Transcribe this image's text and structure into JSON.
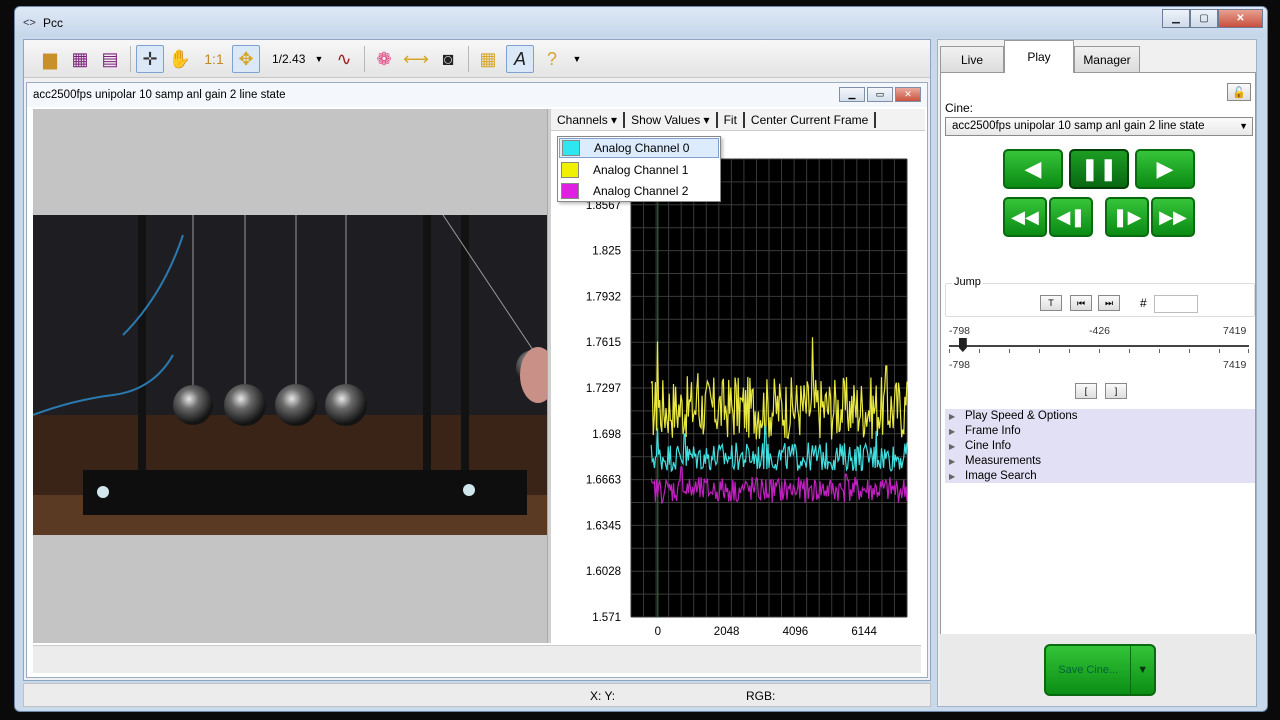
{
  "window": {
    "title": "Pcc"
  },
  "toolbar": {
    "zoom": "1/2.43"
  },
  "document": {
    "title": "acc2500fps unipolar 10 samp anl gain 2 line state"
  },
  "chart_toolbar": {
    "channels": "Channels",
    "show_values": "Show Values",
    "fit": "Fit",
    "center": "Center Current Frame"
  },
  "channels_menu": [
    {
      "label": "Analog Channel 0",
      "color": "#2ee6f0"
    },
    {
      "label": "Analog Channel 1",
      "color": "#f0f000"
    },
    {
      "label": "Analog Channel 2",
      "color": "#e020e0"
    }
  ],
  "chart_data": {
    "type": "line",
    "ylim": [
      1.571,
      1.8885
    ],
    "yticks": [
      "1.8567",
      "1.825",
      "1.7932",
      "1.7615",
      "1.7297",
      "1.698",
      "1.6663",
      "1.6345",
      "1.6028",
      "1.571"
    ],
    "xlim": [
      -798,
      7419
    ],
    "xticks": [
      "0",
      "2048",
      "4096",
      "6144"
    ],
    "grid": true,
    "series": [
      {
        "color": "#e8e840",
        "base": 1.716,
        "amp": 0.022,
        "spikes": [
          {
            "x": 0,
            "y": 1.762
          },
          {
            "x": 1200,
            "y": 1.74
          },
          {
            "x": 2300,
            "y": 1.737
          },
          {
            "x": 4600,
            "y": 1.765
          },
          {
            "x": 6800,
            "y": 1.745
          }
        ]
      },
      {
        "color": "#40e0e0",
        "base": 1.682,
        "amp": 0.01,
        "spikes": [
          {
            "x": 0,
            "y": 1.702
          },
          {
            "x": 800,
            "y": 1.698
          },
          {
            "x": 3200,
            "y": 1.703
          },
          {
            "x": 4700,
            "y": 1.69
          },
          {
            "x": 6500,
            "y": 1.7
          }
        ]
      },
      {
        "color": "#c020c0",
        "base": 1.659,
        "amp": 0.009,
        "spikes": [
          {
            "x": 700,
            "y": 1.675
          },
          {
            "x": 2800,
            "y": 1.668
          },
          {
            "x": 5600,
            "y": 1.67
          }
        ]
      }
    ]
  },
  "status": {
    "xy": "X: Y:",
    "rgb": "RGB:"
  },
  "tabs": [
    "Live",
    "Play",
    "Manager"
  ],
  "play": {
    "cine_label": "Cine:",
    "cine_value": "acc2500fps unipolar 10 samp anl gain 2 line state",
    "jump_label": "Jump",
    "jump_t": "T",
    "hash": "#",
    "range_min": "-798",
    "range_mid": "-426",
    "range_max": "7419",
    "range_min2": "-798",
    "range_max2": "7419",
    "current_fraction": 0.046,
    "sections": [
      "Play Speed & Options",
      "Frame Info",
      "Cine Info",
      "Measurements",
      "Image Search"
    ],
    "save": "Save Cine..."
  }
}
